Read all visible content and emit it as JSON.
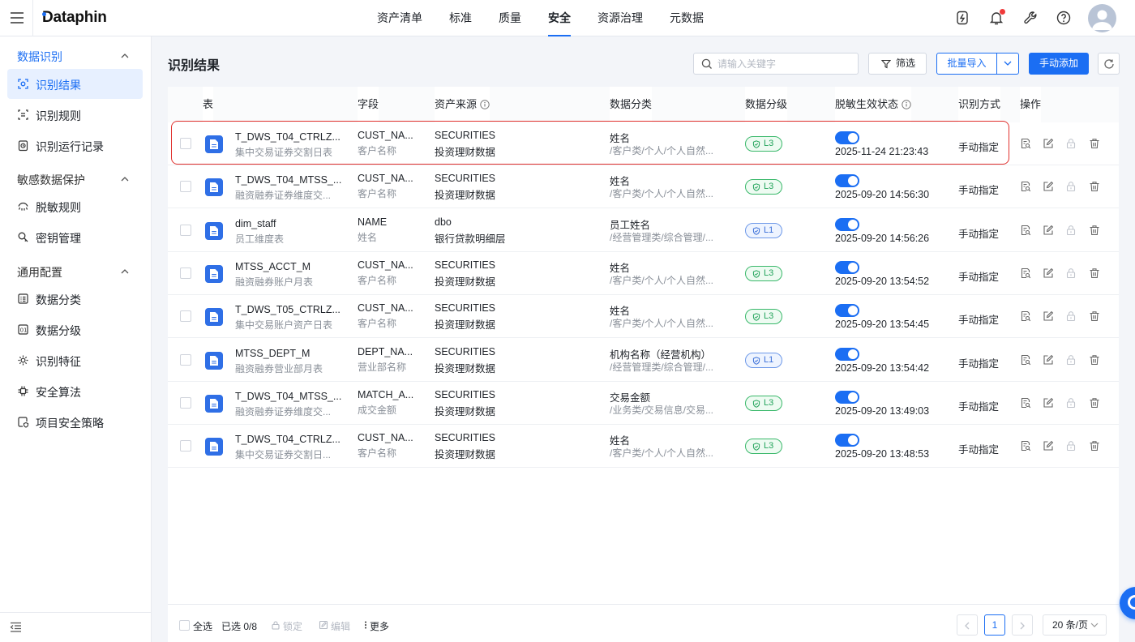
{
  "app": {
    "logo": "Dataphin"
  },
  "topnav": [
    {
      "label": "资产清单",
      "active": false
    },
    {
      "label": "标准",
      "active": false
    },
    {
      "label": "质量",
      "active": false
    },
    {
      "label": "安全",
      "active": true
    },
    {
      "label": "资源治理",
      "active": false
    },
    {
      "label": "元数据",
      "active": false
    }
  ],
  "topicons": [
    "flash-icon",
    "bell-icon",
    "wrench-icon",
    "help-icon"
  ],
  "sidebar": {
    "groups": [
      {
        "label": "数据识别",
        "items": [
          {
            "label": "识别结果",
            "icon": "scan-icon",
            "active": true
          },
          {
            "label": "识别规则",
            "icon": "rule-icon",
            "active": false
          },
          {
            "label": "识别运行记录",
            "icon": "record-icon",
            "active": false
          }
        ]
      },
      {
        "label": "敏感数据保护",
        "items": [
          {
            "label": "脱敏规则",
            "icon": "mask-icon",
            "active": false
          },
          {
            "label": "密钥管理",
            "icon": "key-icon",
            "active": false
          }
        ]
      },
      {
        "label": "通用配置",
        "items": [
          {
            "label": "数据分类",
            "icon": "category-icon",
            "active": false
          },
          {
            "label": "数据分级",
            "icon": "grade-icon",
            "active": false
          },
          {
            "label": "识别特征",
            "icon": "feature-icon",
            "active": false
          },
          {
            "label": "安全算法",
            "icon": "algorithm-icon",
            "active": false
          },
          {
            "label": "项目安全策略",
            "icon": "policy-icon",
            "active": false
          }
        ]
      }
    ]
  },
  "page": {
    "title": "识别结果",
    "search_placeholder": "请输入关键字",
    "filter_label": "筛选",
    "import_label": "批量导入",
    "add_label": "手动添加"
  },
  "table": {
    "headers": {
      "table": "表",
      "field": "字段",
      "source": "资产来源",
      "category": "数据分类",
      "level": "数据分级",
      "status": "脱敏生效状态",
      "method": "识别方式",
      "ops": "操作"
    },
    "rows": [
      {
        "table_name": "T_DWS_T04_CTRLZ...",
        "table_desc": "集中交易证券交割日表",
        "field_name": "CUST_NA...",
        "field_desc": "客户名称",
        "source_name": "SECURITIES",
        "source_desc": "投资理财数据",
        "category_name": "姓名",
        "category_path": "/客户类/个人/个人自然...",
        "level": "L3",
        "enabled": true,
        "time": "2025-11-24 21:23:43",
        "method": "手动指定"
      },
      {
        "table_name": "T_DWS_T04_MTSS_...",
        "table_desc": "融资融券证券维度交...",
        "field_name": "CUST_NA...",
        "field_desc": "客户名称",
        "source_name": "SECURITIES",
        "source_desc": "投资理财数据",
        "category_name": "姓名",
        "category_path": "/客户类/个人/个人自然...",
        "level": "L3",
        "enabled": true,
        "time": "2025-09-20 14:56:30",
        "method": "手动指定"
      },
      {
        "table_name": "dim_staff",
        "table_desc": "员工维度表",
        "field_name": "NAME",
        "field_desc": "姓名",
        "source_name": "dbo",
        "source_desc": "银行贷款明细层",
        "category_name": "员工姓名",
        "category_path": "/经营管理类/综合管理/...",
        "level": "L1",
        "enabled": true,
        "time": "2025-09-20 14:56:26",
        "method": "手动指定"
      },
      {
        "table_name": "MTSS_ACCT_M",
        "table_desc": "融资融券账户月表",
        "field_name": "CUST_NA...",
        "field_desc": "客户名称",
        "source_name": "SECURITIES",
        "source_desc": "投资理财数据",
        "category_name": "姓名",
        "category_path": "/客户类/个人/个人自然...",
        "level": "L3",
        "enabled": true,
        "time": "2025-09-20 13:54:52",
        "method": "手动指定"
      },
      {
        "table_name": "T_DWS_T05_CTRLZ...",
        "table_desc": "集中交易账户资产日表",
        "field_name": "CUST_NA...",
        "field_desc": "客户名称",
        "source_name": "SECURITIES",
        "source_desc": "投资理财数据",
        "category_name": "姓名",
        "category_path": "/客户类/个人/个人自然...",
        "level": "L3",
        "enabled": true,
        "time": "2025-09-20 13:54:45",
        "method": "手动指定"
      },
      {
        "table_name": "MTSS_DEPT_M",
        "table_desc": "融资融券营业部月表",
        "field_name": "DEPT_NA...",
        "field_desc": "营业部名称",
        "source_name": "SECURITIES",
        "source_desc": "投资理财数据",
        "category_name": "机构名称（经营机构）",
        "category_path": "/经营管理类/综合管理/...",
        "level": "L1",
        "enabled": true,
        "time": "2025-09-20 13:54:42",
        "method": "手动指定"
      },
      {
        "table_name": "T_DWS_T04_MTSS_...",
        "table_desc": "融资融券证券维度交...",
        "field_name": "MATCH_A...",
        "field_desc": "成交金额",
        "source_name": "SECURITIES",
        "source_desc": "投资理财数据",
        "category_name": "交易金额",
        "category_path": "/业务类/交易信息/交易...",
        "level": "L3",
        "enabled": true,
        "time": "2025-09-20 13:49:03",
        "method": "手动指定"
      },
      {
        "table_name": "T_DWS_T04_CTRLZ...",
        "table_desc": "集中交易证券交割日...",
        "field_name": "CUST_NA...",
        "field_desc": "客户名称",
        "source_name": "SECURITIES",
        "source_desc": "投资理财数据",
        "category_name": "姓名",
        "category_path": "/客户类/个人/个人自然...",
        "level": "L3",
        "enabled": true,
        "time": "2025-09-20 13:48:53",
        "method": "手动指定"
      }
    ]
  },
  "footer": {
    "select_all": "全选",
    "selected": "已选 0/8",
    "lock": "锁定",
    "edit": "编辑",
    "more": "更多",
    "current_page": "1",
    "page_size": "20 条/页"
  },
  "colors": {
    "accent": "#1b6ef3",
    "l3": "#22a35a",
    "l1": "#3a6fd8",
    "highlight": "#e0302d"
  }
}
